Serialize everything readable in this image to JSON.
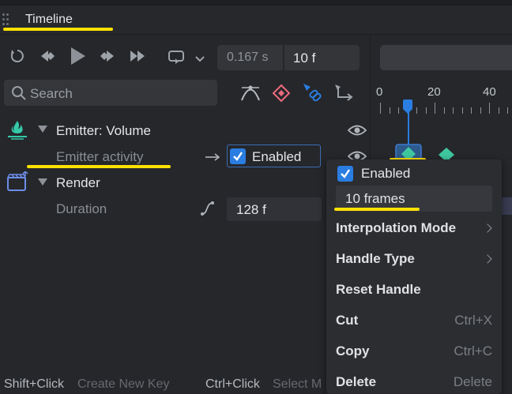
{
  "panel": {
    "title": "Timeline"
  },
  "toolbar": {
    "time_seconds": "0.167 s",
    "time_frames": "10 f",
    "search_placeholder": "Search"
  },
  "ruler": {
    "labels": [
      "0",
      "20",
      "40"
    ]
  },
  "tree": {
    "emitter_label": "Emitter: Volume",
    "emitter_activity_label": "Emitter activity",
    "enabled_label": "Enabled",
    "render_label": "Render",
    "duration_label": "Duration",
    "duration_value": "128 f"
  },
  "menu": {
    "enabled_label": "Enabled",
    "frames_value": "10 frames",
    "items": [
      {
        "label": "Interpolation Mode",
        "shortcut": ""
      },
      {
        "label": "Handle Type",
        "shortcut": ""
      },
      {
        "label": "Reset Handle",
        "shortcut": ""
      },
      {
        "label": "Cut",
        "shortcut": "Ctrl+X"
      },
      {
        "label": "Copy",
        "shortcut": "Ctrl+C"
      },
      {
        "label": "Delete",
        "shortcut": "Delete"
      }
    ]
  },
  "status": {
    "hint1_key": "Shift+Click",
    "hint1_action": "Create New Key",
    "hint2_key": "Ctrl+Click",
    "hint2_action": "Select M"
  },
  "colors": {
    "accent": "#2a7de1",
    "annotation": "#ffe100",
    "keyframe": "#3fc7a0",
    "emitter_icon": "#35c9a8"
  }
}
